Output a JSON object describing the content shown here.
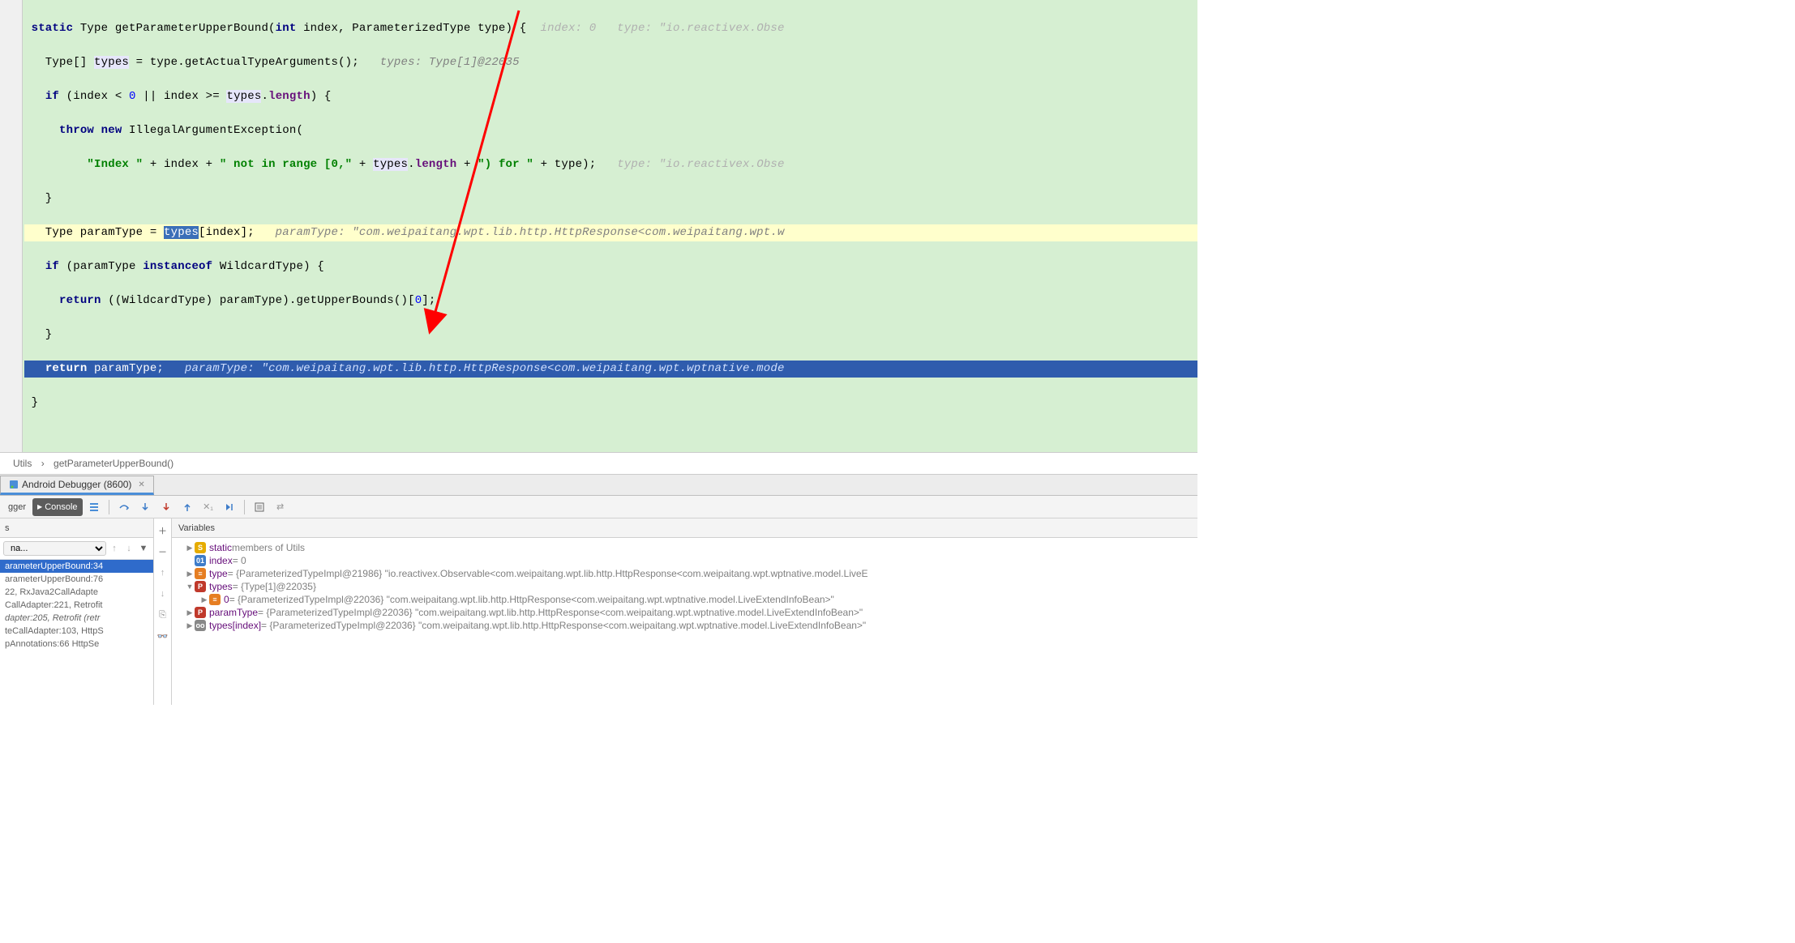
{
  "code": {
    "sig_static": "static",
    "sig_type": " Type getParameterUpperBound(",
    "sig_int": "int",
    "sig_rest": " index, ParameterizedType type) {",
    "sig_hint": "  index: 0   type: \"io.reactivex.Obse",
    "l2a": "   Type[] ",
    "l2_types": "types",
    "l2b": " = type.getActualTypeArguments();",
    "l2_hint": "   types: Type[1]@22035",
    "l3a": "   ",
    "l3_if": "if",
    "l3b": " (index < ",
    "l3_zero": "0",
    "l3c": " || index >= ",
    "l3_types": "types",
    "l3d": ".",
    "l3_len": "length",
    "l3e": ") {",
    "l4a": "     ",
    "l4_throw": "throw new",
    "l4b": " IllegalArgumentException(",
    "l5a": "         ",
    "l5_s1": "\"Index \"",
    "l5b": " + index + ",
    "l5_s2": "\" not in range [0,\"",
    "l5c": " + ",
    "l5_types": "types",
    "l5d": ".",
    "l5_len": "length",
    "l5e": " + ",
    "l5_s3": "\") for \"",
    "l5f": " + type);",
    "l5_hint": "   type: \"io.reactivex.Obse",
    "l6": "   }",
    "l7a": "   Type paramType = ",
    "l7_types": "types",
    "l7b": "[index];",
    "l7_hint": "   paramType: \"com.weipaitang.wpt.lib.http.HttpResponse<com.weipaitang.wpt.w",
    "l8a": "   ",
    "l8_if": "if",
    "l8b": " (paramType ",
    "l8_inst": "instanceof",
    "l8c": " WildcardType) {",
    "l9a": "     ",
    "l9_ret": "return",
    "l9b": " ((WildcardType) paramType).getUpperBounds()[",
    "l9_zero": "0",
    "l9c": "];",
    "l10": "   }",
    "l11a": "   ",
    "l11_ret": "return",
    "l11b": " paramType;",
    "l11_hint": "   paramType: \"com.weipaitang.wpt.lib.http.HttpResponse<com.weipaitang.wpt.wptnative.mode",
    "l12": " }"
  },
  "breadcrumb": {
    "a": "Utils",
    "sep": "›",
    "b": "getParameterUpperBound()"
  },
  "tab": {
    "label": "Android Debugger (8600)"
  },
  "toolbar": {
    "gger": "gger",
    "console": "Console"
  },
  "frames": {
    "header": "s",
    "select": "na...",
    "items": [
      {
        "text": "arameterUpperBound:34",
        "sel": true
      },
      {
        "text": "arameterUpperBound:76",
        "sel": false
      },
      {
        "text": "22, RxJava2CallAdapte",
        "sel": false
      },
      {
        "text": "CallAdapter:221, Retrofit",
        "sel": false
      },
      {
        "text": "dapter:205, Retrofit (retr",
        "sel": false,
        "ital": true
      },
      {
        "text": "teCallAdapter:103, HttpS",
        "sel": false
      },
      {
        "text": "pAnnotations:66  HttpSe",
        "sel": false
      }
    ]
  },
  "vars": {
    "header": "Variables",
    "rows": [
      {
        "indent": 0,
        "tri": "▶",
        "badge": "S",
        "badgeCls": "badge-s",
        "name": "static",
        "rest": " members of Utils"
      },
      {
        "indent": 0,
        "tri": "",
        "badge": "01",
        "badgeCls": "badge-01",
        "name": "index",
        "rest": " = 0"
      },
      {
        "indent": 0,
        "tri": "▶",
        "badge": "≡",
        "badgeCls": "badge-eq",
        "name": "type",
        "rest": " = {ParameterizedTypeImpl@21986} \"io.reactivex.Observable<com.weipaitang.wpt.lib.http.HttpResponse<com.weipaitang.wpt.wptnative.model.LiveE"
      },
      {
        "indent": 0,
        "tri": "▼",
        "badge": "P",
        "badgeCls": "badge-p",
        "name": "types",
        "rest": " = {Type[1]@22035}"
      },
      {
        "indent": 1,
        "tri": "▶",
        "badge": "≡",
        "badgeCls": "badge-eq",
        "name": "0",
        "rest": " = {ParameterizedTypeImpl@22036} \"com.weipaitang.wpt.lib.http.HttpResponse<com.weipaitang.wpt.wptnative.model.LiveExtendInfoBean>\""
      },
      {
        "indent": 0,
        "tri": "▶",
        "badge": "P",
        "badgeCls": "badge-p",
        "name": "paramType",
        "rest": " = {ParameterizedTypeImpl@22036} \"com.weipaitang.wpt.lib.http.HttpResponse<com.weipaitang.wpt.wptnative.model.LiveExtendInfoBean>\""
      },
      {
        "indent": 0,
        "tri": "▶",
        "badge": "oo",
        "badgeCls": "badge-oo",
        "name": "types[index]",
        "rest": " = {ParameterizedTypeImpl@22036} \"com.weipaitang.wpt.lib.http.HttpResponse<com.weipaitang.wpt.wptnative.model.LiveExtendInfoBean>\""
      }
    ]
  }
}
